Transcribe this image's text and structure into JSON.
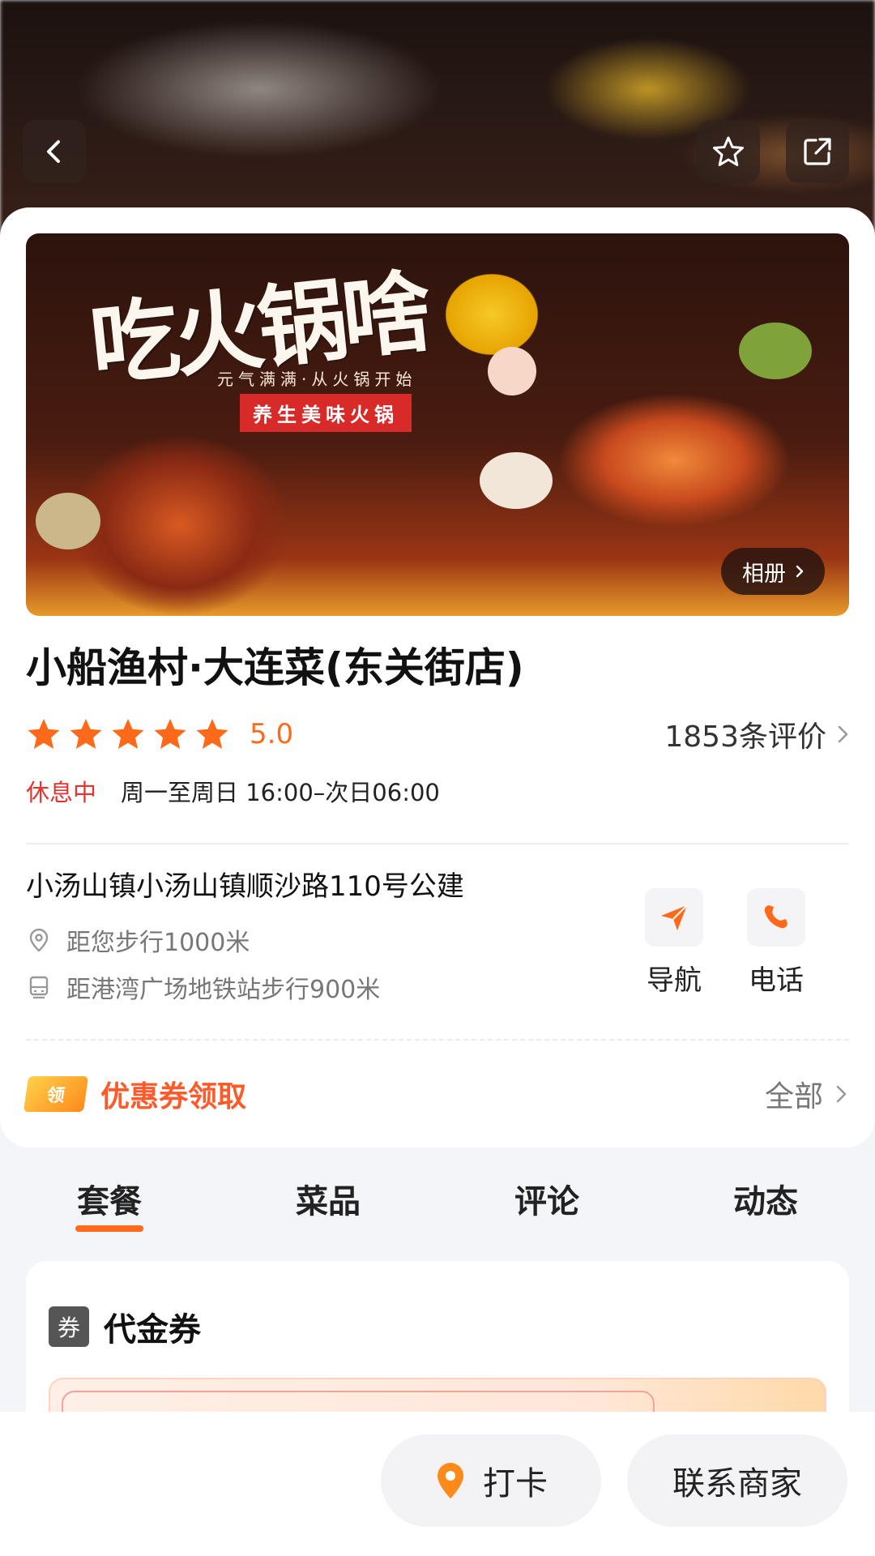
{
  "colors": {
    "accent": "#ff6a1a",
    "status_closed": "#e8332c",
    "coupon": "#ff5a2a"
  },
  "header": {
    "back_icon": "chevron-left-icon",
    "favorite_icon": "star-outline-icon",
    "share_icon": "share-icon"
  },
  "banner": {
    "calligraphy": "吃火锅啥",
    "tagline": "元气满满·从火锅开始",
    "slogan": "养生美味火锅",
    "album_label": "相册"
  },
  "shop": {
    "name": "小船渔村·大连菜(东关街店)",
    "rating": "5.0",
    "rating_value": 5.0,
    "rating_max": 5,
    "reviews_label": "1853条评价",
    "status": "休息中",
    "hours": "周一至周日 16:00–次日06:00",
    "address": "小汤山镇小汤山镇顺沙路110号公建",
    "distance": "距您步行1000米",
    "subway": "距港湾广场地铁站步行900米"
  },
  "actions": {
    "navigate_label": "导航",
    "call_label": "电话"
  },
  "coupon": {
    "tag": "领",
    "title": "优惠券领取",
    "all_label": "全部"
  },
  "tabs": [
    {
      "label": "套餐",
      "active": true
    },
    {
      "label": "菜品",
      "active": false
    },
    {
      "label": "评论",
      "active": false
    },
    {
      "label": "动态",
      "active": false
    }
  ],
  "voucher": {
    "icon_label": "券",
    "title": "代金券"
  },
  "bottom_bar": {
    "checkin_label": "打卡",
    "contact_label": "联系商家"
  }
}
